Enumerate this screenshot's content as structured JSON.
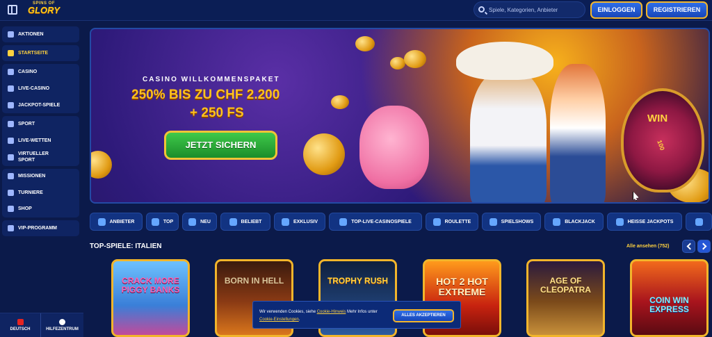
{
  "header": {
    "logo_line1": "SPINS OF",
    "logo_line2": "GLORY",
    "search_placeholder": "Spiele, Kategorien, Anbieter",
    "login_label": "EINLOGGEN",
    "register_label": "REGISTRIEREN"
  },
  "sidebar": {
    "groups": [
      {
        "items": [
          {
            "label": "AKTIONEN",
            "icon": "gift-icon"
          }
        ]
      },
      {
        "items": [
          {
            "label": "STARTSEITE",
            "icon": "home-icon",
            "active": true
          }
        ]
      },
      {
        "items": [
          {
            "label": "CASINO",
            "icon": "slot-icon"
          },
          {
            "label": "LIVE-CASINO",
            "icon": "cards-icon"
          },
          {
            "label": "JACKPOT-SPIELE",
            "icon": "clover-icon"
          }
        ]
      },
      {
        "items": [
          {
            "label": "SPORT",
            "icon": "ball-icon"
          },
          {
            "label": "LIVE-WETTEN",
            "icon": "live-icon"
          },
          {
            "label": "VIRTUELLER SPORT",
            "icon": "gamepad-icon"
          }
        ]
      },
      {
        "items": [
          {
            "label": "MISSIONEN",
            "icon": "target-icon"
          },
          {
            "label": "TURNIERE",
            "icon": "trophy-icon"
          },
          {
            "label": "SHOP",
            "icon": "shop-icon"
          }
        ]
      },
      {
        "items": [
          {
            "label": "VIP-PROGRAMM",
            "icon": "diamond-icon"
          }
        ]
      }
    ],
    "footer": {
      "language_label": "DEUTSCH",
      "help_label": "HILFEZENTRUM"
    }
  },
  "hero": {
    "subtitle": "CASINO WILLKOMMENSPAKET",
    "title_line1": "250% BIS ZU CHF 2.200",
    "title_line2": "+ 250 FS",
    "cta_label": "JETZT SICHERN",
    "wheel_label": "WIN",
    "wheel_value": "100"
  },
  "categories": [
    {
      "label": "ANBIETER",
      "icon": "book-icon"
    },
    {
      "label": "TOP",
      "icon": "crown-icon"
    },
    {
      "label": "NEU",
      "icon": "rocket-icon"
    },
    {
      "label": "BELIEBT",
      "icon": "star-icon"
    },
    {
      "label": "EXKLUSIV",
      "icon": "gem-icon"
    },
    {
      "label": "TOP-LIVE-CASINOSPIELE",
      "icon": "chips-icon"
    },
    {
      "label": "ROULETTE",
      "icon": "roulette-icon"
    },
    {
      "label": "SPIELSHOWS",
      "icon": "mic-icon"
    },
    {
      "label": "BLACKJACK",
      "icon": "spade-icon"
    },
    {
      "label": "HEISSE JACKPOTS",
      "icon": "flame-icon"
    }
  ],
  "section": {
    "title": "TOP-SPIELE: ITALIEN",
    "see_all": "Alle ansehen (752)"
  },
  "games": [
    {
      "title": "CRACK MORE PIGGY BANKS",
      "color": "#5aa9ff"
    },
    {
      "title": "BORN IN HELL",
      "color": "#8a3a14"
    },
    {
      "title": "TROPHY RUSH",
      "color": "#1e3d6f"
    },
    {
      "title": "HOT 2 HOT EXTREME",
      "color": "#c8230f"
    },
    {
      "title": "AGE OF CLEOPATRA",
      "color": "#7b4a1a"
    },
    {
      "title": "COIN WIN EXPRESS",
      "color": "#a8141d"
    }
  ],
  "cookie": {
    "text_before": "Wir verwenden Cookies, siehe ",
    "link1": "Cookie-Hinweis",
    "text_mid": " Mehr Infos unter ",
    "link2": "Cookie-Einstellungen",
    "text_after": ".",
    "accept_label": "ALLES AKZEPTIEREN"
  }
}
